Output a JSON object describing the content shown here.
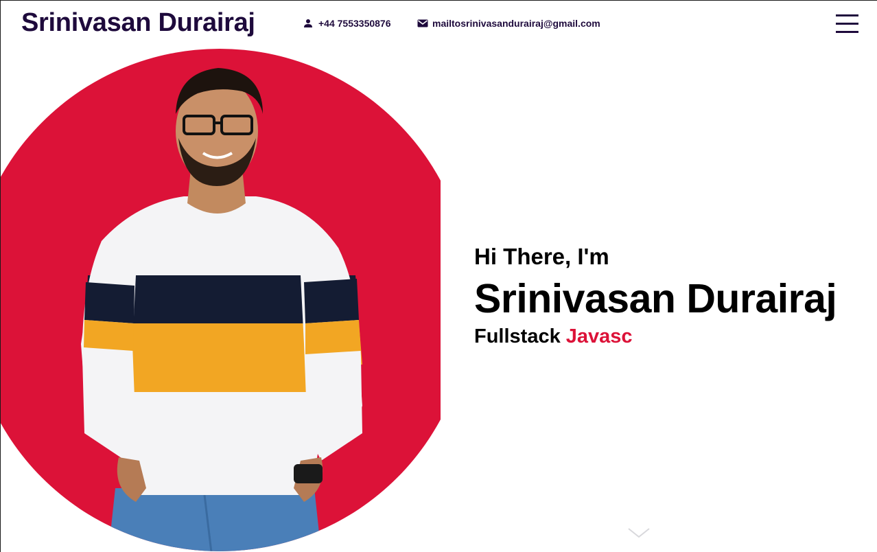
{
  "header": {
    "logo": "Srinivasan Durairaj",
    "phone": "+44 7553350876",
    "email": "mailtosrinivasandurairaj@gmail.com",
    "phone_icon": "person-icon",
    "email_icon": "envelope-icon",
    "menu_icon": "hamburger-menu-icon"
  },
  "hero": {
    "greeting": "Hi There, I'm",
    "name": "Srinivasan Durairaj",
    "role_prefix": "Fullstack",
    "role_accent": "Javasc",
    "scroll_icon": "chevron-down-icon"
  },
  "colors": {
    "brand_dark": "#1e0a3c",
    "accent_red": "#dc1238",
    "background": "#ffffff"
  }
}
